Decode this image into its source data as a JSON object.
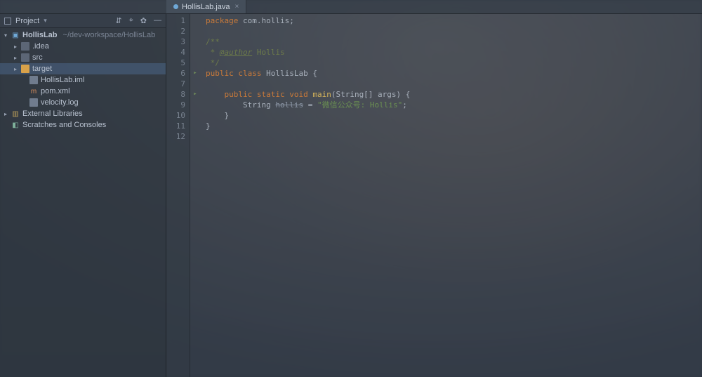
{
  "sidebar": {
    "title": "Project",
    "toolbar": {
      "collapse": "⇵",
      "select": "⌖",
      "settings": "✿",
      "hide": "—"
    },
    "tree": {
      "root": {
        "name": "HollisLab",
        "path": "~/dev-workspace/HollisLab"
      },
      "idea": ".idea",
      "src": "src",
      "target": "target",
      "iml": "HollisLab.iml",
      "pom": "pom.xml",
      "velocity": "velocity.log",
      "ext": "External Libraries",
      "scratch": "Scratches and Consoles"
    }
  },
  "tab": {
    "filename": "HollisLab.java"
  },
  "code": {
    "l1": "package com.hollis;",
    "l2": "",
    "l3": "/**",
    "l4_a": " * ",
    "l4_b": "@author",
    "l4_c": " Hollis",
    "l5": " */",
    "l6_a": "public class ",
    "l6_b": "HollisLab ",
    "l6_c": "{",
    "l7": "",
    "l8_a": "    public static void ",
    "l8_b": "main",
    "l8_c": "(String[] args) {",
    "l9_a": "        String ",
    "l9_b": "hollis",
    "l9_c": " = ",
    "l9_d": "\"微信公众号: Hollis\"",
    "l9_e": ";",
    "l10": "    }",
    "l11": "}",
    "l12": ""
  },
  "gutter": {
    "marks": {
      "6": "▸",
      "8": "▸"
    }
  },
  "lines": [
    "1",
    "2",
    "3",
    "4",
    "5",
    "6",
    "7",
    "8",
    "9",
    "10",
    "11",
    "12"
  ]
}
